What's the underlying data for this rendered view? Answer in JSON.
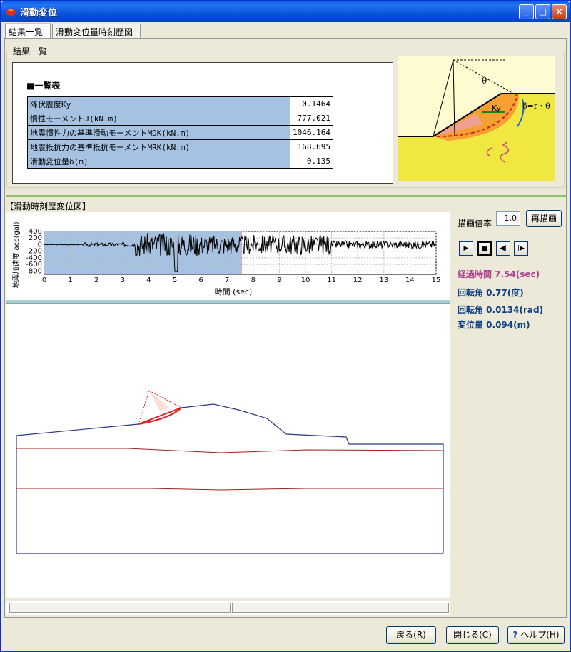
{
  "window": {
    "title": "滑動変位"
  },
  "tabs": [
    "結果一覧",
    "滑動変位量時刻歴図"
  ],
  "summary": {
    "group_label": "結果一覧",
    "table_title": "■一覧表",
    "rows": [
      {
        "label": "降伏震度Ky",
        "value": "0.1464"
      },
      {
        "label": "慣性モーメントJ(kN.m)",
        "value": "777.021"
      },
      {
        "label": "地震慣性力の基準滑動モーメントMDK(kN.m)",
        "value": "1046.164"
      },
      {
        "label": "地震抵抗力の基準抵抗モーメントMRK(kN.m)",
        "value": "168.695"
      },
      {
        "label": "滑動変位量δ(m)",
        "value": "0.135"
      }
    ]
  },
  "illustration": {
    "theta": "θ",
    "ky": "Ky",
    "formula": "δ=r・θ"
  },
  "history": {
    "section_label": "【滑動時刻歴変位図】"
  },
  "chart_data": {
    "type": "line",
    "ylabel": "地震加速度 acc(gal)",
    "xlabel": "時間 (sec)",
    "xlim": [
      0,
      15
    ],
    "ylim": [
      -900,
      400
    ],
    "x_ticks": [
      "0",
      "1",
      "2",
      "3",
      "4",
      "5",
      "6",
      "7",
      "8",
      "9",
      "10",
      "11",
      "12",
      "13",
      "14",
      "15"
    ],
    "y_ticks": [
      "400",
      "200",
      "0",
      "-200",
      "-400",
      "-600",
      "-800"
    ],
    "elapsed_marker": 7.54,
    "grid": true
  },
  "controls": {
    "scale_label": "描画倍率",
    "scale_value": "1.0",
    "redraw": "再描画"
  },
  "status": {
    "elapsed": "経過時間 7.54(sec)",
    "rot_deg": "回転角 0.77(度)",
    "rot_rad": "回転角 0.0134(rad)",
    "disp": "変位量 0.094(m)"
  },
  "buttons": {
    "back": "戻る(R)",
    "close": "閉じる(C)",
    "help": "ヘルプ(H)"
  },
  "colors": {
    "highlight": "#a6c2e3",
    "slip": "#e02020",
    "ground": "#2a3a80",
    "layer": "#a02020"
  }
}
